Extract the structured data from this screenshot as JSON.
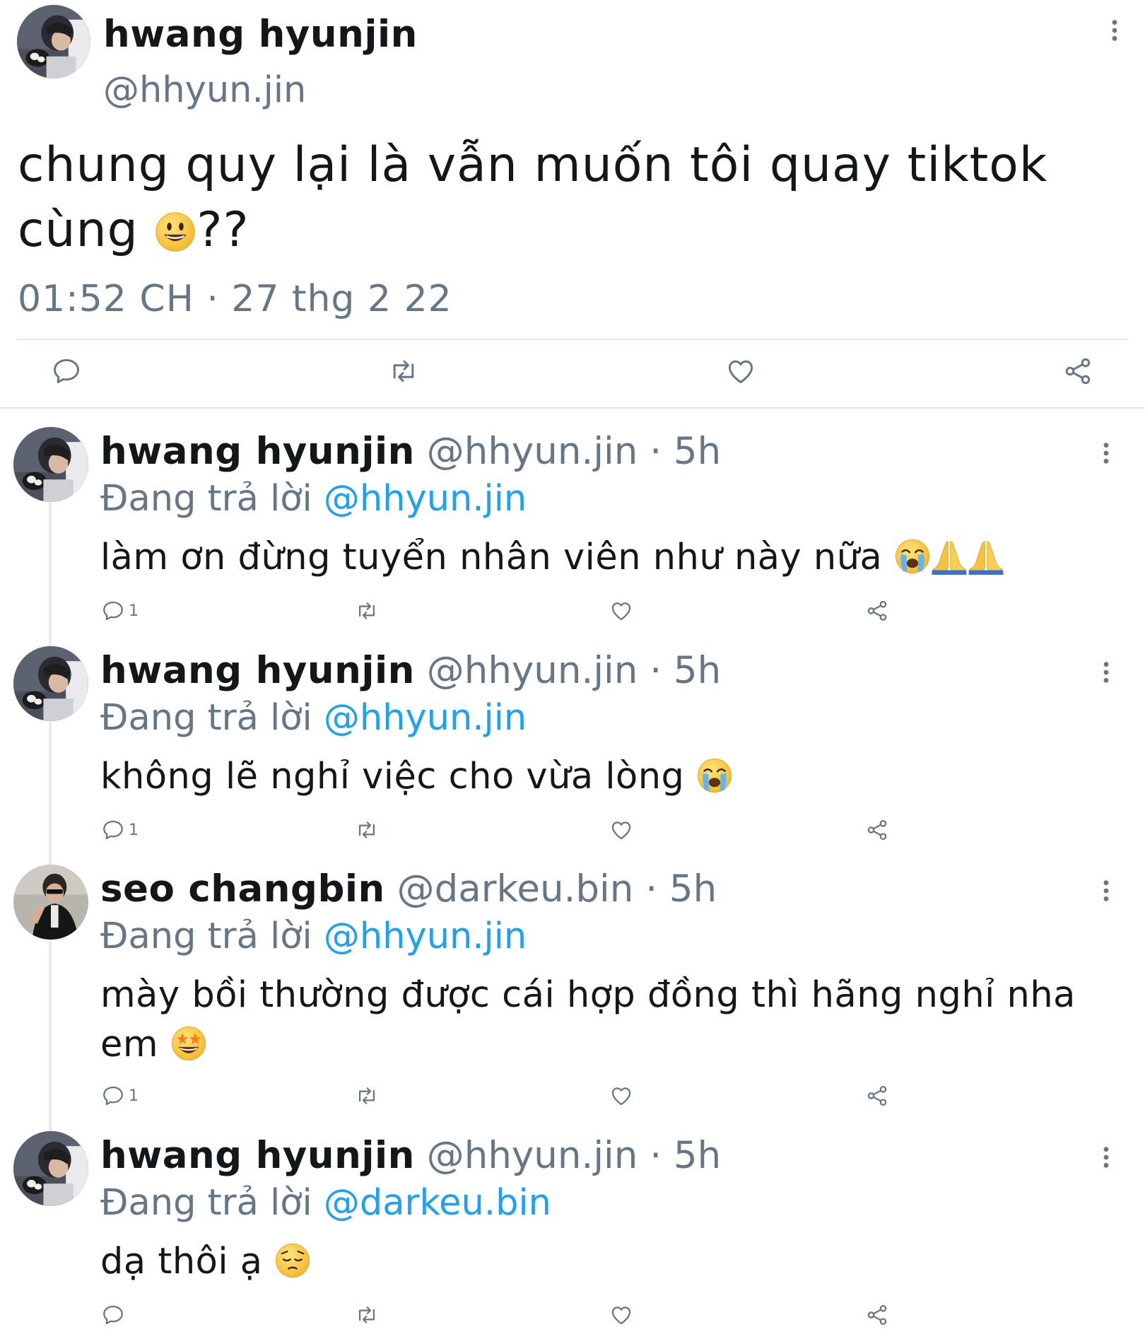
{
  "main_tweet": {
    "author_name": "hwang hyunjin",
    "author_handle": "@hhyun.jin",
    "text_before_emoji": "chung quy lại là vẫn muốn tôi quay tiktok cùng ",
    "emoji": "smiley-face",
    "text_after_emoji": "??",
    "timestamp": "01:52 CH · 27 thg 2 22",
    "actions": [
      "reply-icon",
      "retweet-icon",
      "like-icon",
      "share-icon"
    ]
  },
  "replies": [
    {
      "author_name": "hwang hyunjin",
      "author_handle": "@hhyun.jin",
      "time": "5h",
      "separator": " · ",
      "replying_label": "Đang trả lời ",
      "replying_to": "@hhyun.jin",
      "text": "làm ơn đừng tuyển nhân viên như này nữa ",
      "emojis": [
        "crying-face",
        "folded-hands",
        "folded-hands"
      ],
      "reply_count": "1"
    },
    {
      "author_name": "hwang hyunjin",
      "author_handle": "@hhyun.jin",
      "time": "5h",
      "separator": " · ",
      "replying_label": "Đang trả lời ",
      "replying_to": "@hhyun.jin",
      "text": "không lẽ nghỉ việc cho vừa lòng ",
      "emojis": [
        "crying-face"
      ],
      "reply_count": "1"
    },
    {
      "author_name": "seo changbin",
      "author_handle": "@darkeu.bin",
      "time": "5h",
      "separator": " · ",
      "replying_label": "Đang trả lời ",
      "replying_to": "@hhyun.jin",
      "text": "mày bồi thường được cái hợp đồng thì hãng nghỉ nha em ",
      "emojis": [
        "star-struck"
      ],
      "reply_count": "1"
    },
    {
      "author_name": "hwang hyunjin",
      "author_handle": "@hhyun.jin",
      "time": "5h",
      "separator": " · ",
      "replying_label": "Đang trả lời ",
      "replying_to": "@darkeu.bin",
      "text": "dạ thôi ạ ",
      "emojis": [
        "pensive-face"
      ],
      "reply_count": ""
    }
  ],
  "colors": {
    "text": "#14171a",
    "secondary": "#657786",
    "link": "#1da1f2",
    "divider": "#e1e8ed"
  }
}
